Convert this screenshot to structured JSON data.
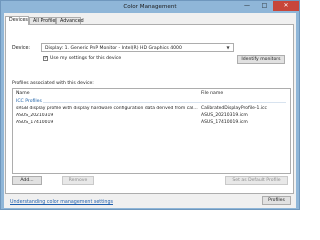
{
  "window": {
    "title": "Color Management",
    "minimize_glyph": "—",
    "maximize_glyph": "□",
    "close_glyph": "✕"
  },
  "tabs": [
    "Devices",
    "All Profiles",
    "Advanced"
  ],
  "device": {
    "label": "Device:",
    "selected": "Display: 1. Generic PnP Monitor - Intel(R) HD Graphics 4000",
    "use_settings_label": "Use my settings for this device",
    "use_settings_checked": true,
    "identify_button": "Identify monitors"
  },
  "profiles": {
    "label": "Profiles associated with this device:",
    "columns": {
      "name": "Name",
      "file": "File name"
    },
    "group": "ICC Profiles",
    "rows": [
      {
        "name": "sRGB display profile with display hardware configuration data derived from cali...",
        "file": "CalibratedDisplayProfile-1.icc"
      },
      {
        "name": "ASUS_20210319",
        "file": "ASUS_20210319.icm"
      },
      {
        "name": "ASUS_17410019",
        "file": "ASUS_17410019.icm"
      }
    ]
  },
  "buttons": {
    "add": "Add...",
    "remove": "Remove",
    "set_default": "Set as Default Profile",
    "profiles": "Profiles"
  },
  "footer_link": "Understanding color management settings",
  "colors": {
    "title_bar": "#8fb6d8",
    "close_button": "#c7463a",
    "group_header": "#1a5fa6",
    "link": "#1f5fae"
  },
  "icons": {
    "dropdown": "chevron-down-icon",
    "checkbox": "checkmark-icon"
  }
}
